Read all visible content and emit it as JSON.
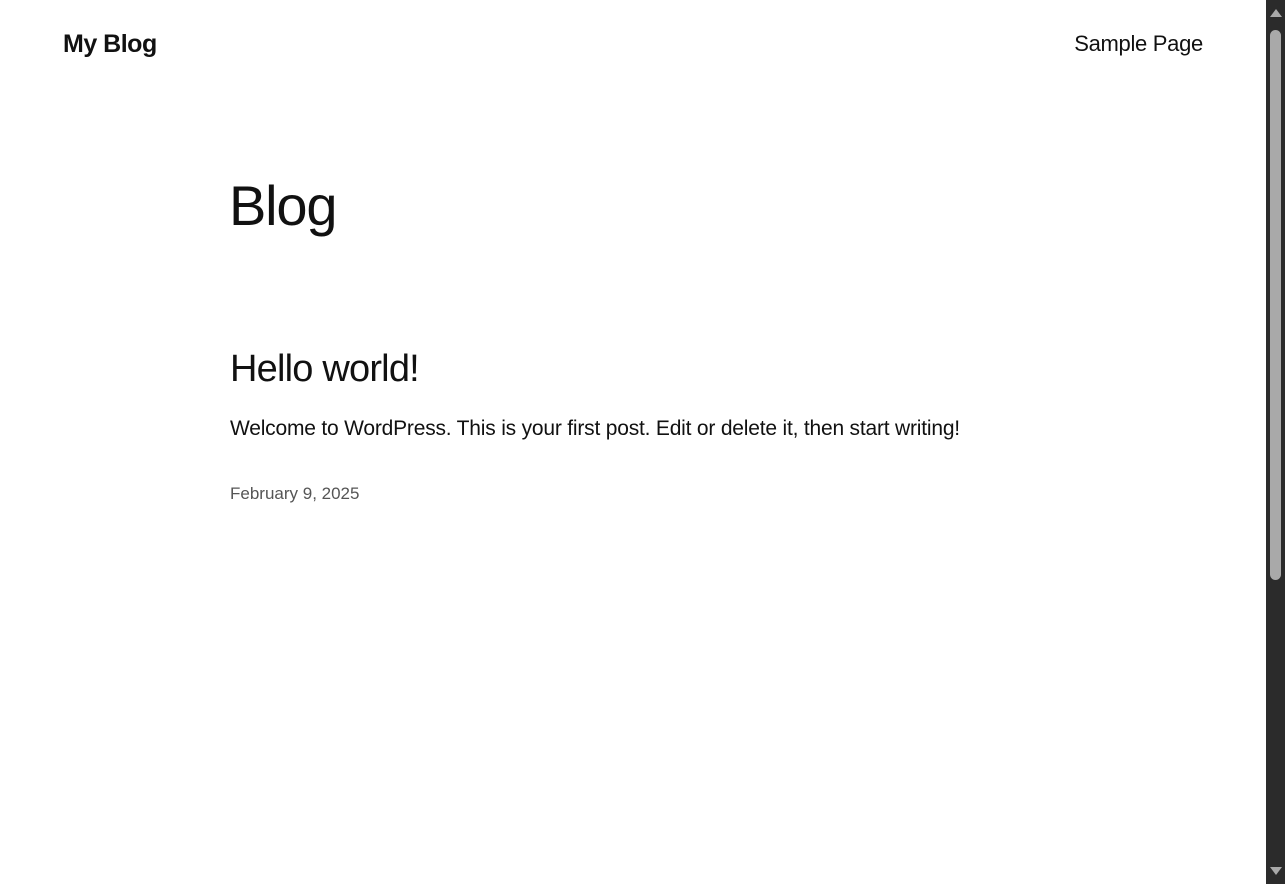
{
  "header": {
    "site_title": "My Blog",
    "nav": [
      {
        "label": "Sample Page"
      }
    ]
  },
  "main": {
    "page_title": "Blog",
    "posts": [
      {
        "title": "Hello world!",
        "excerpt": "Welcome to WordPress. This is your first post. Edit or delete it, then start writing!",
        "date": "February 9, 2025"
      }
    ]
  },
  "scrollbar": {
    "thumb_fraction": 0.62
  }
}
